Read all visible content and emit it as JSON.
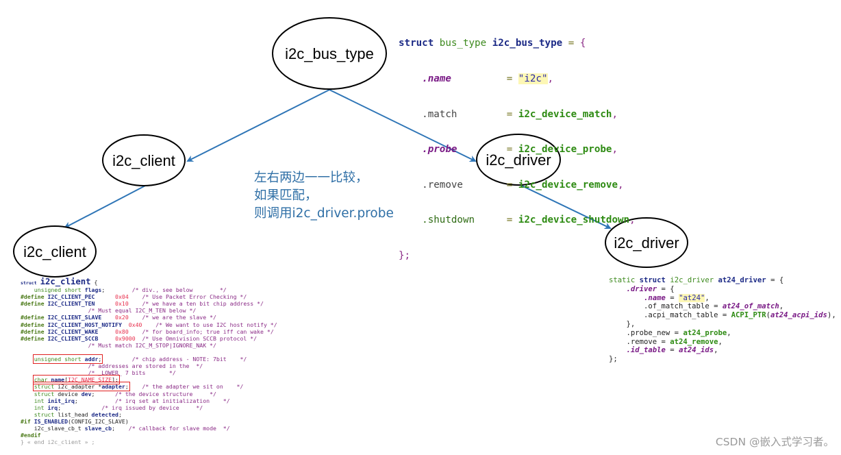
{
  "nodes": {
    "bus_type": "i2c_bus_type",
    "client_top": "i2c_client",
    "driver_top": "i2c_driver",
    "client_bottom": "i2c_client",
    "driver_bottom": "i2c_driver"
  },
  "annotation": {
    "line1": "左右两边一一比较，",
    "line2": "如果匹配，",
    "line3": "则调用i2c_driver.probe"
  },
  "bus_type_code": {
    "l0": [
      "struct",
      "bus_type",
      "i2c_bus_type",
      "=",
      "{"
    ],
    "fields": [
      {
        "name": ".name",
        "eq": "=",
        "value": "\"i2c\"",
        "end": ","
      },
      {
        "name": ".match",
        "eq": "=",
        "value": "i2c_device_match",
        "end": ","
      },
      {
        "name": ".probe",
        "eq": "=",
        "value": "i2c_device_probe",
        "end": ","
      },
      {
        "name": ".remove",
        "eq": "=",
        "value": "i2c_device_remove",
        "end": ","
      },
      {
        "name": ".shutdown",
        "eq": "=",
        "value": "i2c_device_shutdown",
        "end": ","
      }
    ],
    "close": "};"
  },
  "client_code": {
    "lines": [
      "struct i2c_client {",
      "    unsigned short flags;        /* div., see below        */",
      "#define I2C_CLIENT_PEC      0x04    /* Use Packet Error Checking */",
      "#define I2C_CLIENT_TEN      0x10    /* we have a ten bit chip address */",
      "                    /* Must equal I2C_M_TEN below */",
      "#define I2C_CLIENT_SLAVE    0x20    /* we are the slave */",
      "#define I2C_CLIENT_HOST_NOTIFY  0x40    /* We want to use I2C host notify */",
      "#define I2C_CLIENT_WAKE     0x80    /* for board_info; true iff can wake */",
      "#define I2C_CLIENT_SCCB     0x9000  /* Use Omnivision SCCB protocol */",
      "                    /* Must match I2C_M_STOP|IGNORE_NAK */",
      "",
      "    unsigned short addr;         /* chip address - NOTE: 7bit    */",
      "                    /* addresses are stored in the  */",
      "                    /* _LOWER_ 7 bits       */",
      "    char name[I2C_NAME_SIZE];",
      "    struct i2c_adapter *adapter;    /* the adapter we sit on    */",
      "    struct device dev;      /* the device structure     */",
      "    int init_irq;           /* irq set at initialization    */",
      "    int irq;            /* irq issued by device     */",
      "    struct list_head detected;",
      "#if IS_ENABLED(CONFIG_I2C_SLAVE)",
      "    i2c_slave_cb_t slave_cb;    /* callback for slave mode  */",
      "#endif",
      "} « end i2c_client » ;"
    ]
  },
  "driver_code": {
    "lines": [
      "static struct i2c_driver at24_driver = {",
      "    .driver = {",
      "        .name = \"at24\",",
      "        .of_match_table = at24_of_match,",
      "        .acpi_match_table = ACPI_PTR(at24_acpi_ids),",
      "    },",
      "    .probe_new = at24_probe,",
      "    .remove = at24_remove,",
      "    .id_table = at24_ids,",
      "};"
    ]
  },
  "watermark": "CSDN @嵌入式学习者。",
  "colors": {
    "arrow": "#2e75b6",
    "annotation": "#2f6fa6",
    "highlight_box": "#e02020",
    "ellipse_stroke": "#000000"
  }
}
